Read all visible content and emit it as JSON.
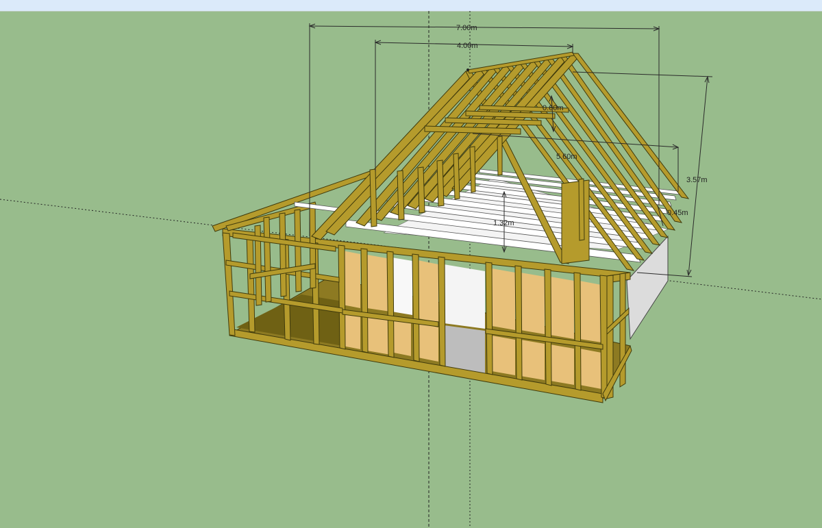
{
  "app": {
    "sky_color": "#dbeafa",
    "ground_color": "#98bc8c",
    "timber_color": "#b59b2c",
    "timber_edge_color": "#3f3a0c",
    "osb_color": "#e8c17a",
    "plaster_color": "#f6f6f6",
    "axis_color": "#111111",
    "dimension_line_color": "#2a2a2a"
  },
  "dimensions": {
    "overall_length": "7.00m",
    "roof_width": "4.00m",
    "ridge_height": "3.57m",
    "rafter_length": "5.60m",
    "collar_spacing": "0.60m",
    "knee_wall_height": "1.32m",
    "eave_offset": "0.45m"
  },
  "model": {
    "subject": "timber-frame-house-model",
    "rafter_pairs": 9,
    "wall_panels": 8
  }
}
